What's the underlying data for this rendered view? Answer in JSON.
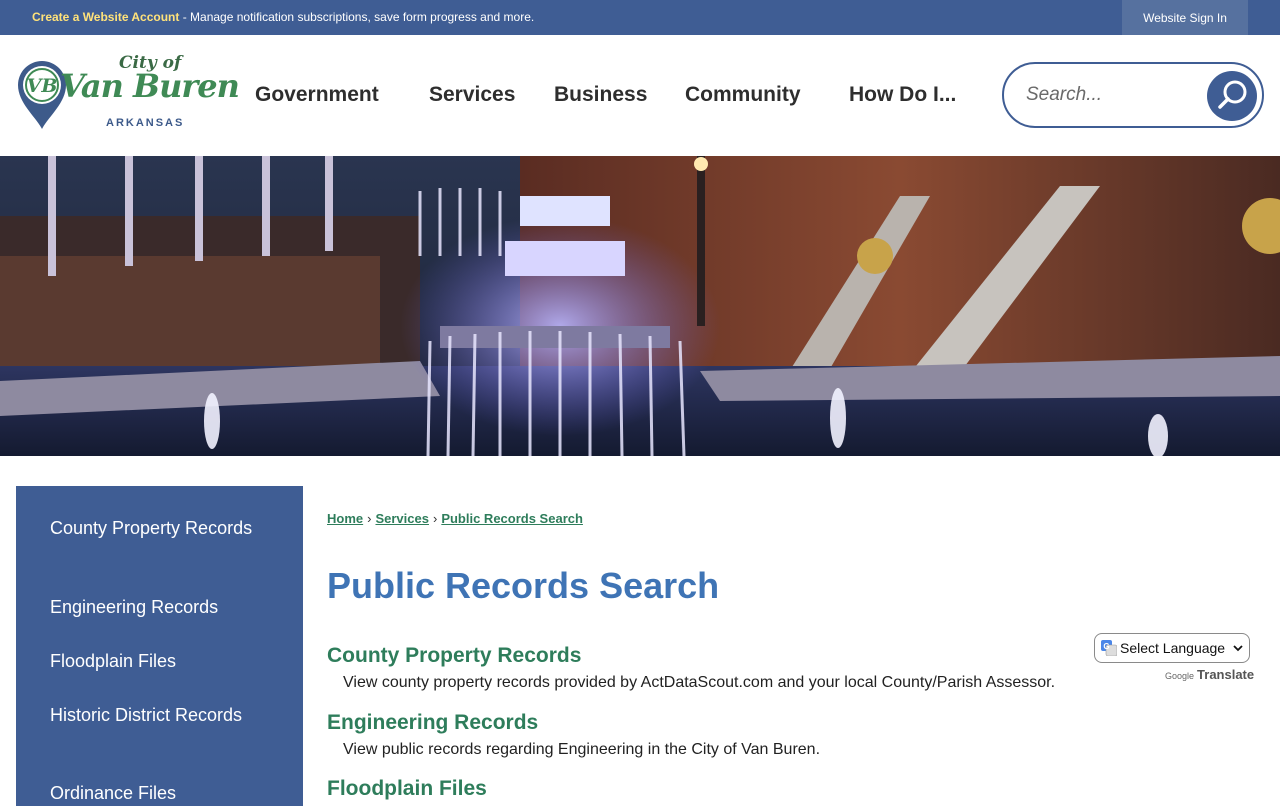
{
  "topbar": {
    "create_link": "Create a Website Account",
    "create_desc": " - Manage notification subscriptions, save form progress and more.",
    "signin": "Website Sign In"
  },
  "logo": {
    "city_of": "City of",
    "name": "Van Buren",
    "state": "ARKANSAS",
    "monogram": "VB"
  },
  "nav": {
    "items": [
      "Government",
      "Services",
      "Business",
      "Community",
      "How Do I..."
    ]
  },
  "search": {
    "placeholder": "Search..."
  },
  "sidebar": {
    "items": [
      "County Property Records",
      "Engineering Records",
      "Floodplain Files",
      "Historic District Records",
      "Ordinance Files"
    ]
  },
  "breadcrumb": [
    "Home",
    "Services",
    "Public Records Search"
  ],
  "page_title": "Public Records Search",
  "records": [
    {
      "title": "County Property Records",
      "desc": "View county property records provided by ActDataScout.com and your local County/Parish Assessor."
    },
    {
      "title": "Engineering Records",
      "desc": "View public records regarding Engineering in the City of Van Buren."
    },
    {
      "title": "Floodplain Files",
      "desc": ""
    }
  ],
  "translate": {
    "select_label": "Select Language",
    "powered_by": "Google",
    "translate_word": "Translate"
  },
  "colors": {
    "brand_blue": "#3f5d94",
    "title_blue": "#3f74b5",
    "link_green": "#2e7d5b",
    "highlight_yellow": "#ffe27a"
  }
}
